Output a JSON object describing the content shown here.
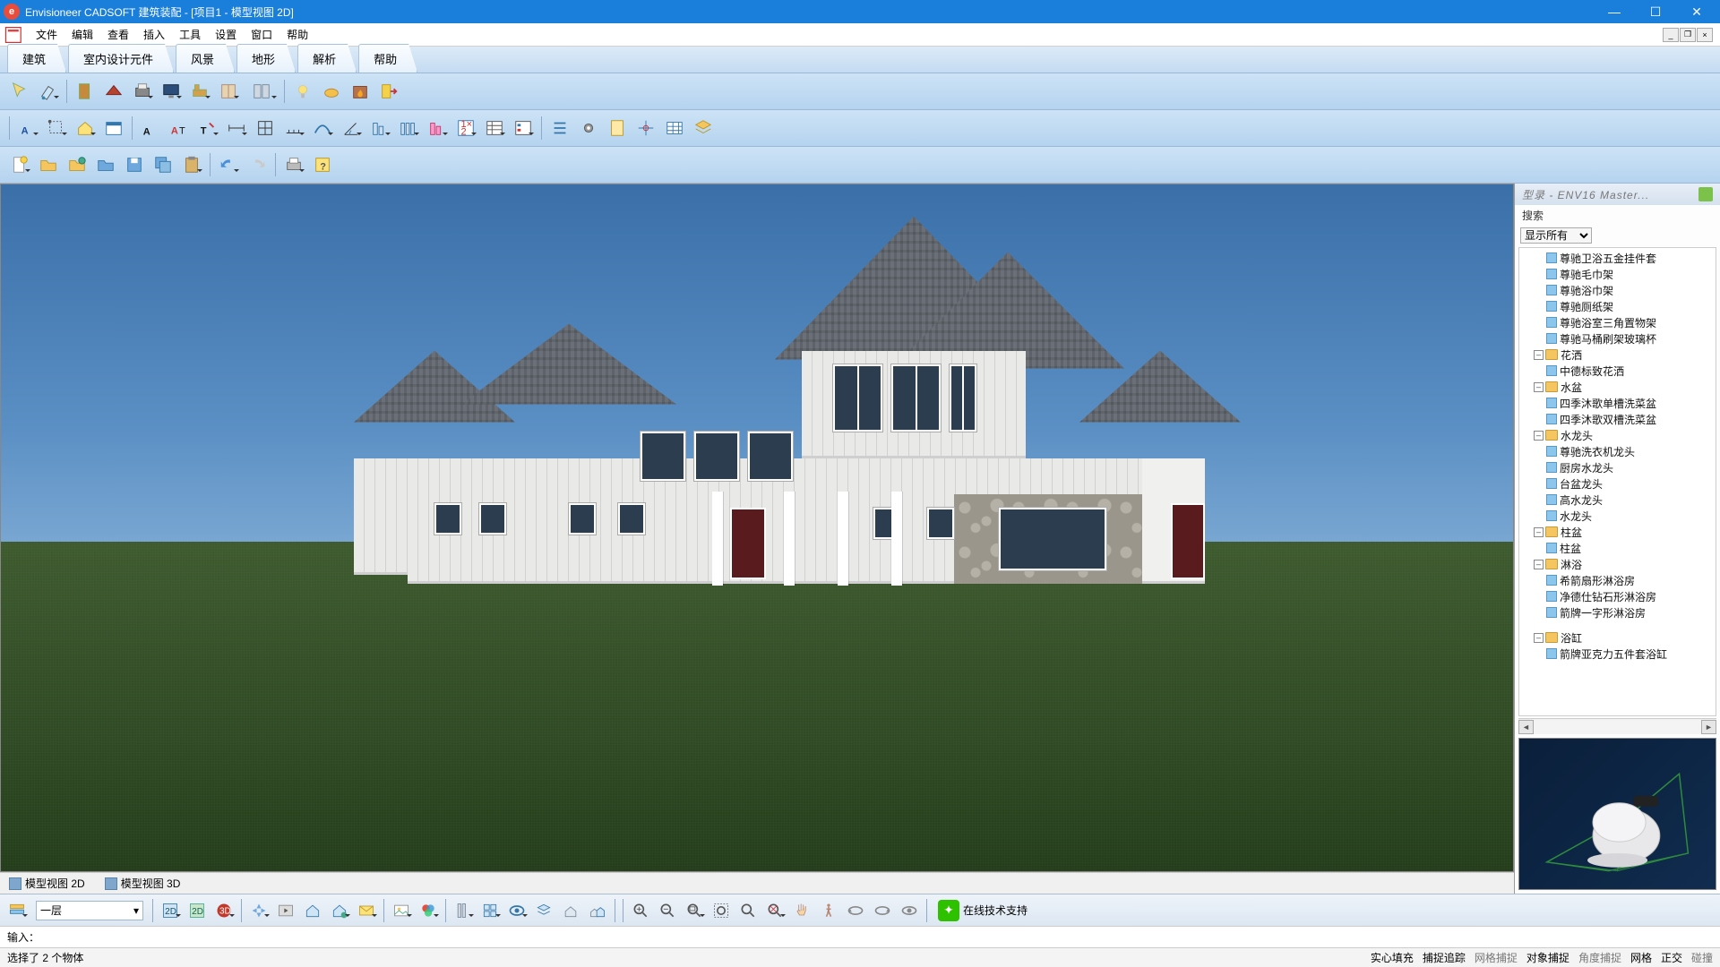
{
  "title": "Envisioneer CADSOFT 建筑装配 - [项目1 - 模型视图 2D]",
  "menus": [
    "文件",
    "编辑",
    "查看",
    "插入",
    "工具",
    "设置",
    "窗口",
    "帮助"
  ],
  "ribbon_tabs": [
    "建筑",
    "室内设计元件",
    "风景",
    "地形",
    "解析",
    "帮助"
  ],
  "view_tabs": {
    "tab1": "模型视图 2D",
    "tab2": "模型视图 3D"
  },
  "sidebar": {
    "title": "型录 - ENV16 Master...",
    "search_label": "搜索",
    "filter_selected": "显示所有",
    "tree": [
      {
        "t": "item",
        "lbl": "尊驰卫浴五金挂件套",
        "ind": 2
      },
      {
        "t": "item",
        "lbl": "尊驰毛巾架",
        "ind": 2
      },
      {
        "t": "item",
        "lbl": "尊驰浴巾架",
        "ind": 2
      },
      {
        "t": "item",
        "lbl": "尊驰厕纸架",
        "ind": 2
      },
      {
        "t": "item",
        "lbl": "尊驰浴室三角置物架",
        "ind": 2
      },
      {
        "t": "item",
        "lbl": "尊驰马桶刷架玻璃杯",
        "ind": 2
      },
      {
        "t": "folder",
        "lbl": "花洒",
        "ind": 1,
        "open": true
      },
      {
        "t": "item",
        "lbl": "中德标致花洒",
        "ind": 2
      },
      {
        "t": "folder",
        "lbl": "水盆",
        "ind": 1,
        "open": true
      },
      {
        "t": "item",
        "lbl": "四季沐歌单槽洗菜盆",
        "ind": 2
      },
      {
        "t": "item",
        "lbl": "四季沐歌双槽洗菜盆",
        "ind": 2
      },
      {
        "t": "folder",
        "lbl": "水龙头",
        "ind": 1,
        "open": true
      },
      {
        "t": "item",
        "lbl": "尊驰洗衣机龙头",
        "ind": 2
      },
      {
        "t": "item",
        "lbl": "厨房水龙头",
        "ind": 2
      },
      {
        "t": "item",
        "lbl": "台盆龙头",
        "ind": 2
      },
      {
        "t": "item",
        "lbl": "高水龙头",
        "ind": 2
      },
      {
        "t": "item",
        "lbl": "水龙头",
        "ind": 2
      },
      {
        "t": "folder",
        "lbl": "柱盆",
        "ind": 1,
        "open": true
      },
      {
        "t": "item",
        "lbl": "柱盆",
        "ind": 2
      },
      {
        "t": "folder",
        "lbl": "淋浴",
        "ind": 1,
        "open": true
      },
      {
        "t": "item",
        "lbl": "希箭扇形淋浴房",
        "ind": 2
      },
      {
        "t": "item",
        "lbl": "净德仕钻石形淋浴房",
        "ind": 2
      },
      {
        "t": "item",
        "lbl": "箭牌一字形淋浴房",
        "ind": 2
      },
      {
        "t": "spacer"
      },
      {
        "t": "folder",
        "lbl": "浴缸",
        "ind": 1,
        "open": true
      },
      {
        "t": "item",
        "lbl": "箭牌亚克力五件套浴缸",
        "ind": 2
      }
    ]
  },
  "bottom": {
    "floor": "一层",
    "support": "在线技术支持"
  },
  "input_label": "输入：",
  "status_left": "选择了 2 个物体",
  "status_right": [
    {
      "lbl": "实心填充",
      "on": true
    },
    {
      "lbl": "捕捉追踪",
      "on": true
    },
    {
      "lbl": "网格捕捉",
      "on": false
    },
    {
      "lbl": "对象捕捉",
      "on": true
    },
    {
      "lbl": "角度捕捉",
      "on": false
    },
    {
      "lbl": "网格",
      "on": true
    },
    {
      "lbl": "正交",
      "on": true
    },
    {
      "lbl": "碰撞",
      "on": false
    }
  ]
}
